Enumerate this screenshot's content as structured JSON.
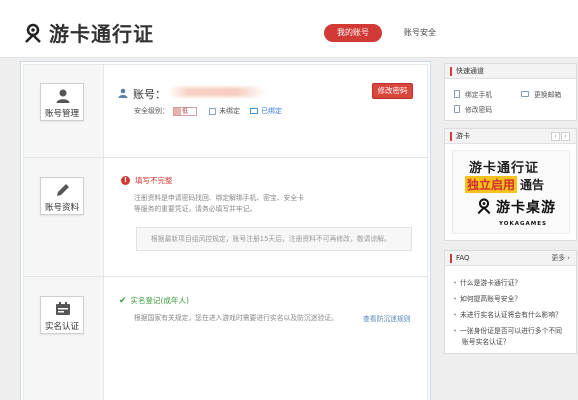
{
  "header": {
    "logo_text": "游卡通行证",
    "nav_active": "我的账号",
    "nav_second": "账号安全"
  },
  "sidebar": {
    "items": [
      {
        "label": "账号管理",
        "icon": "user-icon"
      },
      {
        "label": "账号资料",
        "icon": "pencil-icon"
      },
      {
        "label": "实名认证",
        "icon": "id-card-icon"
      }
    ]
  },
  "account": {
    "label": "账号：",
    "change_password": "修改密码",
    "security_level_label": "安全级别：",
    "security_level_value": "低",
    "security_level_fraction": 0.33,
    "phone_status": "未绑定",
    "email_status": "已绑定"
  },
  "profile": {
    "warning_title": "填写不完整",
    "desc_line1": "注册资料是申请密码找回、绑定解绑手机、密宝、安全卡",
    "desc_line2": "等服务的重要凭证，请务必填写并牢记。",
    "notice": "根据最新项目组风控规定，账号注册15天后，注册资料不可再修改，敬请谅解。"
  },
  "realname": {
    "status_title": "实名登记(成年人)",
    "desc": "根据国家有关规定，您在进入游戏时需要进行实名以及防沉迷验证。",
    "rule_link": "查看防沉迷规则"
  },
  "quick": {
    "title": "快速通道",
    "links": [
      "绑定手机",
      "更换邮箱",
      "修改密码"
    ]
  },
  "youka": {
    "title": "游卡",
    "prev": "‹",
    "next": "›",
    "banner_line1": "游卡通行证",
    "banner_highlight": "独立启用",
    "banner_notice": "通告",
    "banner_brand": "游卡桌游",
    "banner_brand_en": "YOKAGAMES"
  },
  "faq": {
    "title": "FAQ",
    "more": "更多 ›",
    "items": [
      "什么是游卡通行证？",
      "如何提高账号安全？",
      "未进行实名认证将会有什么影响？",
      "一张身份证是否可以进行多个不同",
      "账号实名认证？"
    ]
  },
  "colors": {
    "accent": "#d23a36",
    "success": "#3a9a3a",
    "link": "#3b7dd8"
  }
}
